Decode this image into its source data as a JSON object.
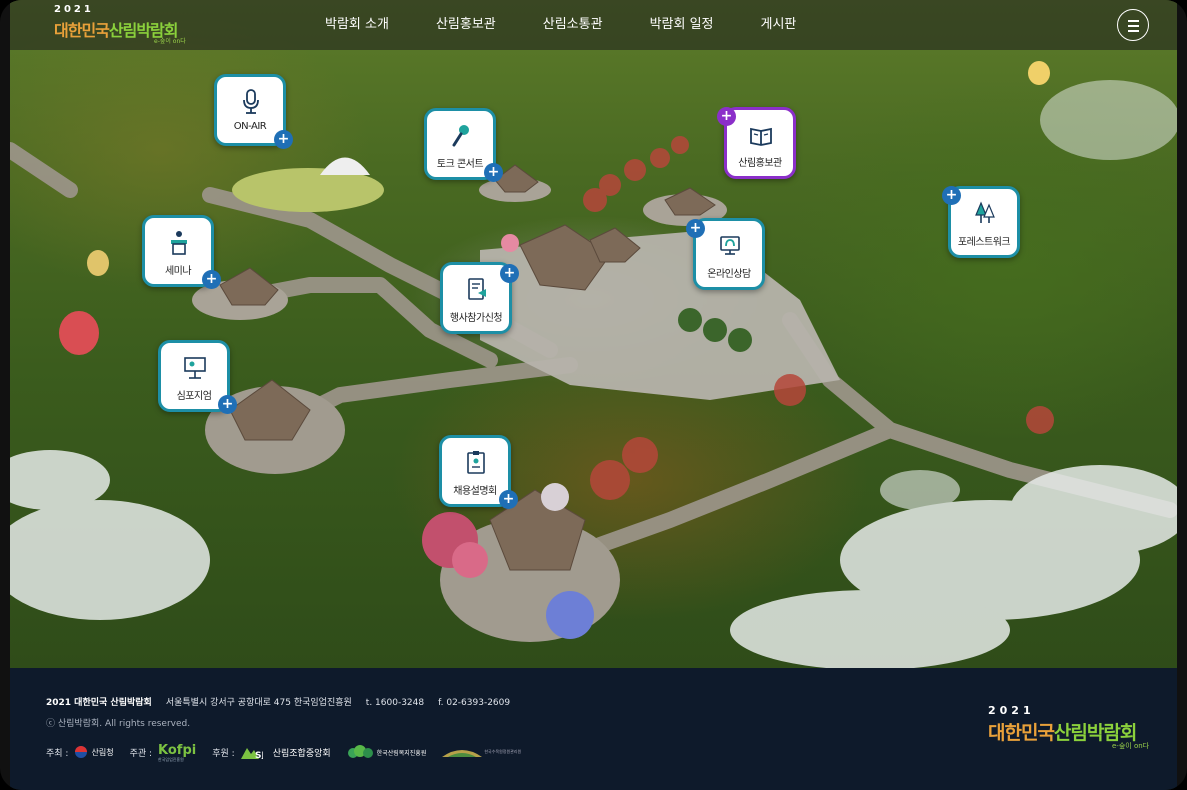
{
  "header": {
    "logo": {
      "year": "2021",
      "name_part1": "대한민국",
      "name_part2": "산림박람회",
      "tagline": "e-숲이 on다"
    },
    "nav": [
      "박람회 소개",
      "산림홍보관",
      "산림소통관",
      "박람회 일정",
      "게시판"
    ]
  },
  "hotspots": [
    {
      "label": "ON-AIR",
      "icon": "microphone-icon"
    },
    {
      "label": "토크 콘서트",
      "icon": "handheld-mic-icon"
    },
    {
      "label": "산림홍보관",
      "icon": "open-book-icon",
      "accent": "#8b2fc9"
    },
    {
      "label": "포레스트워크",
      "icon": "trees-icon"
    },
    {
      "label": "세미나",
      "icon": "podium-icon"
    },
    {
      "label": "행사참가신청",
      "icon": "application-form-icon"
    },
    {
      "label": "온라인상담",
      "icon": "monitor-headset-icon"
    },
    {
      "label": "심포지엄",
      "icon": "presentation-board-icon"
    },
    {
      "label": "채용설명회",
      "icon": "resume-document-icon"
    }
  ],
  "footer": {
    "org": "2021 대한민국 산림박람회",
    "address": "서울특별시 강서구 공항대로 475 한국임업진흥원",
    "tel": "t. 1600-3248",
    "fax": "f. 02-6393-2609",
    "copyright": "ⓒ 산림박람회. All rights reserved.",
    "sponsors": {
      "host_label": "주최 :",
      "host": "산림청",
      "organizer_label": "주관 :",
      "organizer": "Kofpi",
      "organizer_sub": "한국임업진흥원",
      "support_label": "후원 :",
      "support": [
        "산림조합중앙회",
        "한국산림복지진흥원",
        "한국수목원정원관리원"
      ]
    },
    "logo": {
      "year": "2021",
      "name_part1": "대한민국",
      "name_part2": "산림박람회",
      "tagline": "e-숲이 on다"
    }
  },
  "colors": {
    "accent_teal": "#1d8fa6",
    "accent_purple": "#8b2fc9",
    "plus_blue": "#1f6fb6",
    "footer_bg": "#0e1a2b",
    "logo_orange": "#e9a13a",
    "logo_green": "#8bd13c"
  }
}
